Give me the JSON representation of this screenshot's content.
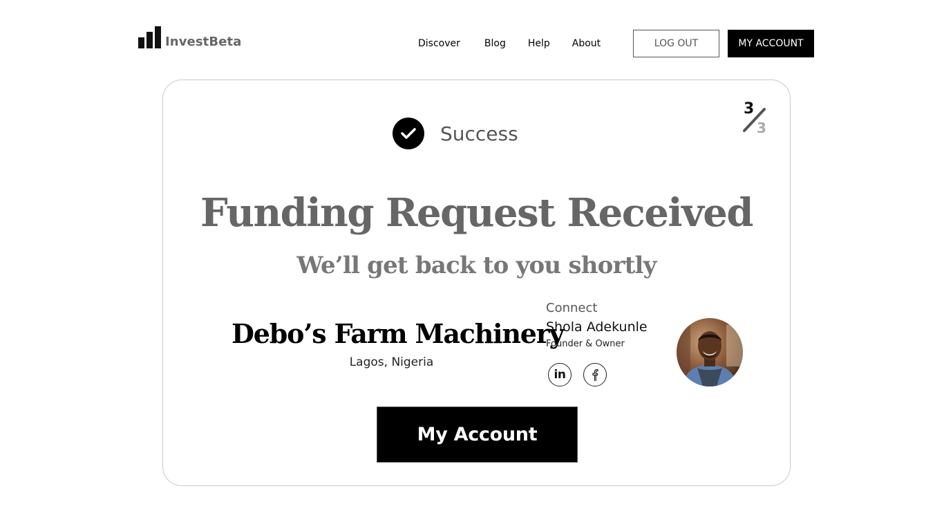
{
  "header": {
    "logo_text": "InvestBeta",
    "nav": {
      "discover": "Discover",
      "blog": "Blog",
      "help": "Help",
      "about": "About"
    },
    "logout_label": "LOG OUT",
    "my_account_label": "MY ACCOUNT"
  },
  "step": {
    "current": "3",
    "total": "3"
  },
  "status": {
    "label": "Success"
  },
  "headline": "Funding Request Received",
  "subheadline": "We’ll get back to you shortly",
  "business": {
    "name": "Debo’s Farm Machinery",
    "location": "Lagos, Nigeria"
  },
  "contact": {
    "connect_label": "Connect",
    "owner_name": "Shola Adekunle",
    "owner_role": "Founder & Owner",
    "linkedin_label": "in"
  },
  "primary_button": {
    "label": "My Account"
  },
  "colors": {
    "primary": "#000000",
    "muted_text": "#666666",
    "card_border": "#c8c8c8"
  }
}
